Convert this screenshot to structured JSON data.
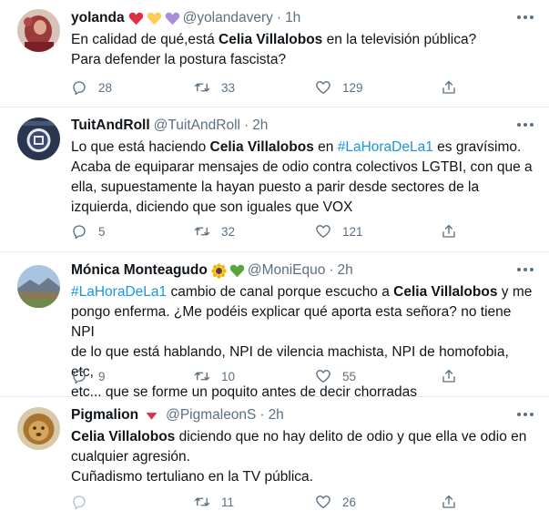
{
  "tweets": [
    {
      "name": "yolanda",
      "handle": "@yolandavery",
      "dot": "·",
      "time": "1h",
      "emojis": [
        "red-heart",
        "yellow-heart",
        "purple-heart"
      ],
      "lines": [
        [
          {
            "t": "En calidad de qué,está "
          },
          {
            "t": "Celia Villalobos",
            "b": true
          },
          {
            "t": " en la televisión pública?"
          }
        ],
        [
          {
            "t": "Para defender la postura fascista?"
          }
        ]
      ],
      "replies": "28",
      "retweets": "33",
      "likes": "129"
    },
    {
      "name": "TuitAndRoll",
      "handle": "@TuitAndRoll",
      "dot": "·",
      "time": "2h",
      "emojis": [],
      "lines": [
        [
          {
            "t": "Lo que está haciendo "
          },
          {
            "t": "Celia Villalobos",
            "b": true
          },
          {
            "t": " en "
          },
          {
            "t": "#LaHoraDeLa1",
            "h": true
          },
          {
            "t": " es gravísimo."
          }
        ],
        [
          {
            "t": "Acaba de equiparar mensajes de odio contra colectivos LGTBI, con que a"
          }
        ],
        [
          {
            "t": "ella, supuestamente la hayan puesto a parir desde sectores de la"
          }
        ],
        [
          {
            "t": "izquierda, diciendo que son iguales que VOX"
          }
        ]
      ],
      "replies": "5",
      "retweets": "32",
      "likes": "121"
    },
    {
      "name": "Mónica Monteagudo",
      "handle": "@MoniEquo",
      "dot": "·",
      "time": "2h",
      "emojis": [
        "sunflower",
        "green-heart"
      ],
      "lines": [
        [
          {
            "t": "#LaHoraDeLa1",
            "h": true
          },
          {
            "t": " cambio de canal porque escucho a "
          },
          {
            "t": "Celia Villalobos",
            "b": true
          },
          {
            "t": " y me"
          }
        ],
        [
          {
            "t": "pongo enferma. ¿Me podéis explicar qué aporta esta señora? no tiene NPI"
          }
        ],
        [
          {
            "t": "de lo que está hablando, NPI de vilencia machista, NPI de homofobia, etc,"
          }
        ],
        [
          {
            "t": "etc... que se forme un poquito antes de decir chorradas"
          }
        ]
      ],
      "replies": "9",
      "retweets": "10",
      "likes": "55"
    },
    {
      "name": "Pigmalion",
      "handle": "@PigmaleonS",
      "dot": "·",
      "time": "2h",
      "emojis": [
        "red-triangle-down"
      ],
      "lines": [
        [
          {
            "t": "Celia Villalobos",
            "b": true
          },
          {
            "t": " diciendo que no hay delito de odio y que ella ve odio en"
          }
        ],
        [
          {
            "t": "cualquier agresión."
          }
        ],
        [
          {
            "t": "Cuñadismo tertuliano en la TV pública."
          }
        ]
      ],
      "replies": "",
      "retweets": "11",
      "likes": "26"
    }
  ],
  "icons": {
    "reply": "reply-icon",
    "retweet": "retweet-icon",
    "like": "heart-icon",
    "share": "share-icon",
    "more": "more-options-icon"
  },
  "colors": {
    "text": "#0f1419",
    "secondary": "#5b7083",
    "hashtag": "#1b95e0",
    "divider": "#e6ecf0"
  }
}
